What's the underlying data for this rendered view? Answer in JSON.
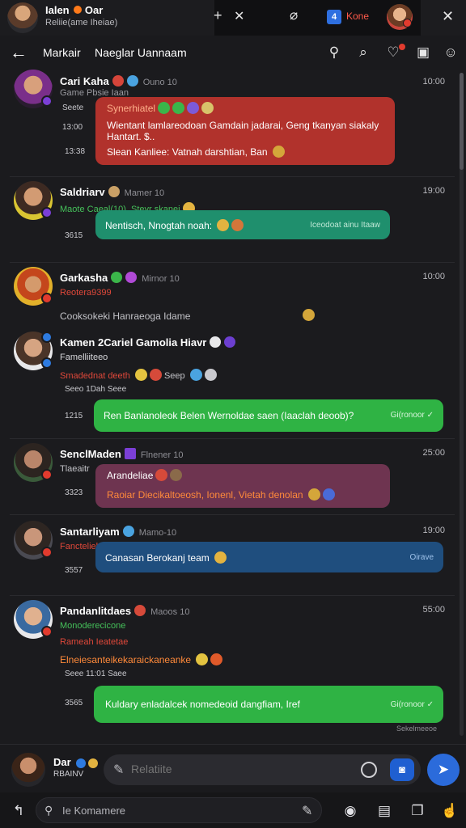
{
  "window": {
    "title": "Ialen",
    "title_extra": "Oar",
    "subtitle": "Reliie(ame Iheiae)",
    "tab_label": "Kone",
    "tab_badge": "4"
  },
  "nav": {
    "tab1": "Markair",
    "tab2": "Naeglar Uannaam"
  },
  "messages": [
    {
      "name": "Cari Kaha",
      "meta": "Ouno 10",
      "time": "10:00",
      "sub": "Game Pbsie Iaan",
      "left_labels": [
        "Seete",
        "13:00",
        "13:38"
      ],
      "bubble_title": "Synerhiatel",
      "bubble_lines": [
        "Wientant lamlareodoan Gamdain jadarai, Geng tkanyan siakaly",
        "Hantart. $..",
        "Slean Kanliee:  Vatnah darshtian, Ban "
      ],
      "bubble_color": "#b1322c"
    },
    {
      "name": "Saldriarv",
      "meta": "Mamer 10",
      "time": "19:00",
      "sub": "Maote Caeal(10), Steyr  skanei",
      "left_labels": [
        "3615"
      ],
      "bubble_text": "Nentisch, Nnogtah noah: ",
      "bubble_hint": "Iceodoat ainu Itaaw",
      "bubble_color": "#1f8f6d"
    },
    {
      "name": "Garkasha",
      "meta": "Mirnor 10",
      "time": "10:00",
      "sub": "Reotera9399",
      "plain_text": "Cooksokeki Hanraeoga Idame"
    },
    {
      "name": "Kamen 2Cariel Gamolia Hiavr",
      "time": "",
      "sub": "Famelliiteeo",
      "sub2": "Smadednat deeth ",
      "sub2b": "Seep ",
      "left_labels": [
        "Seeo 1Dah Seee",
        "1215"
      ],
      "bubble_text": "Ren Banlanoleok Belen Wernoldae saen (Iaaclah deoob)?",
      "bubble_hint": "Gi(ronoor",
      "bubble_color": "#2fb344"
    },
    {
      "name": "SenclMaden",
      "meta": "Flnener 10",
      "time": "25:00",
      "sub": "Tlaeaitr",
      "left_labels": [
        "3323"
      ],
      "bubble_title": "Arandeliae",
      "bubble_text": "Raoiar  Diecikaltoeosh, Ionenl,  Vietah denolan ",
      "bubble_color": "#6e3450"
    },
    {
      "name": "Santarliyam",
      "meta": "Mamo-10",
      "time": "19:00",
      "sub": "Fancteliehsiaoste",
      "left_labels": [
        "3557"
      ],
      "bubble_text": "Canasan Berokanj team ",
      "bubble_hint": "Oirave",
      "bubble_color": "#1f4e7e"
    },
    {
      "name": "Pandanlitdaes",
      "meta": "Maoos 10",
      "time": "55:00",
      "sub": "Monoderecicone",
      "sub2": "Rameah Ieatetae",
      "sub3": "Elneiesanteikekaraickaneanke ",
      "left_labels": [
        "Seee 11:01 Saee",
        "3565"
      ],
      "bubble_text": "Kuldary enladalcek nomedeoid dangfiam, Iref",
      "bubble_hint": "Gi(ronoor",
      "bubble_color": "#2fb344",
      "footer": "Sekelmeeoe"
    }
  ],
  "composer": {
    "user_name": "Dar",
    "user_sub": "RBAINV",
    "placeholder": "Relatiite"
  },
  "bottom": {
    "search_placeholder": "Ie Komamere"
  }
}
